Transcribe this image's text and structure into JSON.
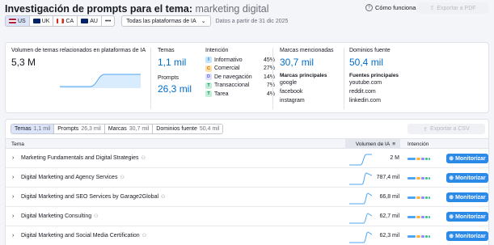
{
  "header": {
    "title": "Investigación de prompts para el tema:",
    "topic": "marketing digital",
    "how_it_works": "Cómo funciona",
    "export_pdf": "Exportar a PDF"
  },
  "controls": {
    "countries": [
      {
        "code": "US",
        "flag": "us",
        "active": true
      },
      {
        "code": "UK",
        "flag": "uk",
        "active": false
      },
      {
        "code": "CA",
        "flag": "ca",
        "active": false
      },
      {
        "code": "AU",
        "flag": "au",
        "active": false
      }
    ],
    "more": "•••",
    "platforms": "Todas las plataformas de IA",
    "date_note": "Datos a partir de 31 dic 2025"
  },
  "summary": {
    "volume_label": "Volumen de temas relacionados en plataformas de IA",
    "volume_value": "5,3 M",
    "topics_label": "Temas",
    "topics_value": "1,1 mil",
    "prompts_label": "Prompts",
    "prompts_value": "26,3 mil",
    "intent_label": "Intención",
    "intents": [
      {
        "letter": "I",
        "name": "Informativo",
        "pct": "45%",
        "bg": "#c4e5fe",
        "fg": "#006dca"
      },
      {
        "letter": "C",
        "name": "Comercial",
        "pct": "27%",
        "bg": "#ffe0a6",
        "fg": "#bc6c0a"
      },
      {
        "letter": "D",
        "name": "De navegación",
        "pct": "14%",
        "bg": "#dfe1fd",
        "fg": "#5e62d6"
      },
      {
        "letter": "T",
        "name": "Transaccional",
        "pct": "7%",
        "bg": "#c5eed9",
        "fg": "#00875f"
      },
      {
        "letter": "T",
        "name": "Tarea",
        "pct": "4%",
        "bg": "#c5eed9",
        "fg": "#00875f"
      }
    ],
    "brands_label": "Marcas mencionadas",
    "brands_value": "30,7 mil",
    "brands_sub": "Marcas principales",
    "brands": [
      "google",
      "facebook",
      "instagram"
    ],
    "domains_label": "Dominios fuente",
    "domains_value": "50,4 mil",
    "domains_sub": "Fuentes principales",
    "domains": [
      "youtube.com",
      "reddit.com",
      "linkedin.com"
    ]
  },
  "table": {
    "tabs": [
      {
        "label": "Temas",
        "count": "1,1 mil",
        "active": true
      },
      {
        "label": "Prompts",
        "count": "26,3 mil",
        "active": false
      },
      {
        "label": "Marcas",
        "count": "30,7 mil",
        "active": false
      },
      {
        "label": "Dominios fuente",
        "count": "50,4 mil",
        "active": false
      }
    ],
    "export_csv": "Exportar a CSV",
    "col_topic": "Tema",
    "col_volume": "Volumen de IA",
    "col_intent": "Intención",
    "monitor_label": "Monitorizar",
    "rows": [
      {
        "name": "Marketing Fundamentals and Digital Strategies",
        "volume": "2 M"
      },
      {
        "name": "Digital Marketing and Agency Services",
        "volume": "787,4 mil"
      },
      {
        "name": "Digital Marketing and SEO Services by Garage2Global",
        "volume": "66,8 mil"
      },
      {
        "name": "Digital Marketing Consulting",
        "volume": "62,7 mil"
      },
      {
        "name": "Digital Marketing and Social Media Certification",
        "volume": "62,3 mil"
      }
    ]
  },
  "colors": {
    "primary": "#2b8ae8",
    "metric_blue": "#006dca",
    "sparkline": "#4fa6f0"
  }
}
